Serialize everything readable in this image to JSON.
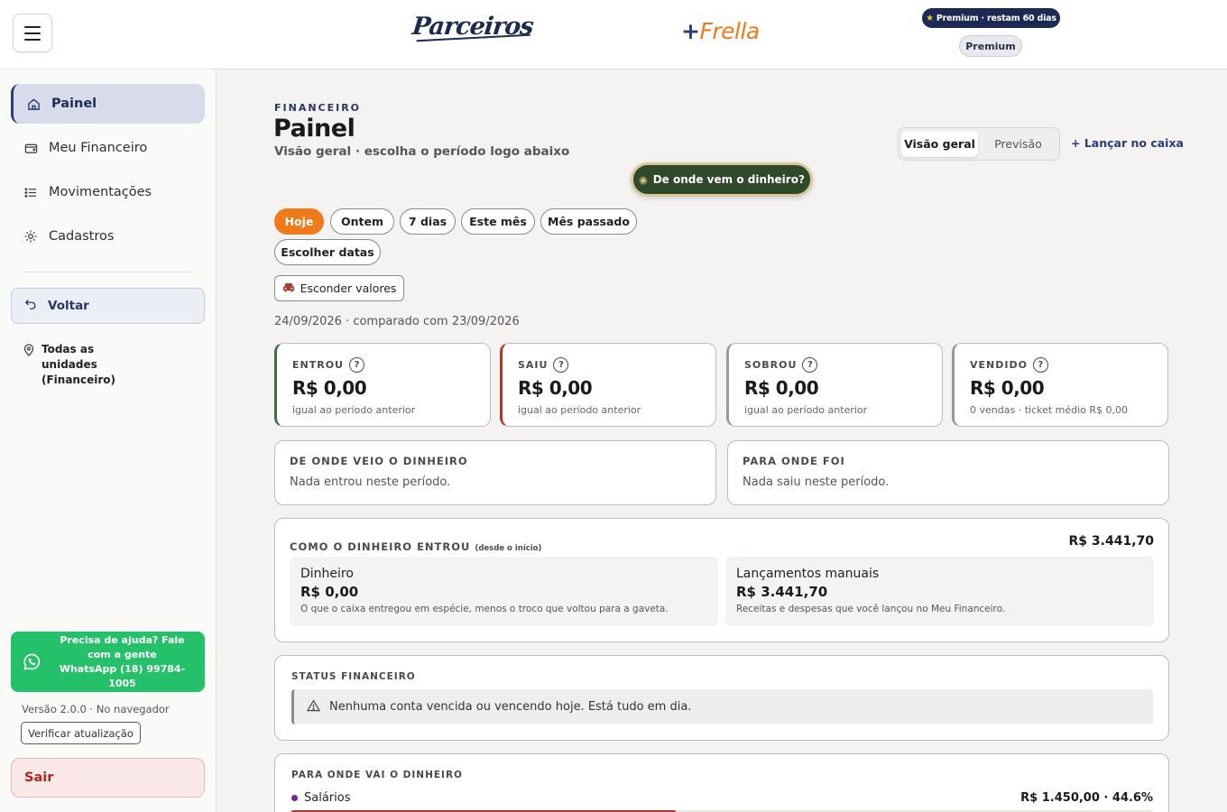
{
  "header": {
    "menu_label": "Menu",
    "logo_parceiros": "Parceiros",
    "logo_frella_plus": "+",
    "logo_frella_name": "Frella",
    "premium_badge": "Premium · restam 60 dias",
    "premium_pill": "Premium"
  },
  "sidebar": {
    "items": [
      {
        "label": "Painel",
        "icon": "home-icon"
      },
      {
        "label": "Meu Financeiro",
        "icon": "wallet-icon"
      },
      {
        "label": "Movimentações",
        "icon": "list-icon"
      },
      {
        "label": "Cadastros",
        "icon": "gear-icon"
      }
    ],
    "back_label": "Voltar",
    "units_label": "Todas as unidades (Financeiro)",
    "help_line1": "Precisa de ajuda? Fale com a gente",
    "help_line2": "WhatsApp (18) 99784-1005",
    "version": "Versão 2.0.0 · No navegador",
    "update_label": "Verificar atualização",
    "logout_label": "Sair"
  },
  "page": {
    "eyebrow": "FINANCEIRO",
    "title": "Painel",
    "subtitle": "Visão geral · escolha o período logo abaixo",
    "tabs": [
      "Visão geral",
      "Previsão"
    ],
    "active_tab": "Visão geral",
    "launch_link": "+ Lançar no caixa",
    "origin_button": "De onde vem o dinheiro?",
    "periods": [
      "Hoje",
      "Ontem",
      "7 dias",
      "Este mês",
      "Mês passado",
      "Escolher datas"
    ],
    "active_period": "Hoje",
    "hide_values": "Esconder valores",
    "compare_text": "24/09/2026 · comparado com 23/09/2026"
  },
  "kpis": [
    {
      "label": "ENTROU",
      "value": "R$ 0,00",
      "note": "igual ao período anterior",
      "color": "#3e6b45"
    },
    {
      "label": "SAIU",
      "value": "R$ 0,00",
      "note": "igual ao período anterior",
      "color": "#b0392b"
    },
    {
      "label": "SOBROU",
      "value": "R$ 0,00",
      "note": "igual ao período anterior",
      "color": "#9a9a9a"
    },
    {
      "label": "VENDIDO",
      "value": "R$ 0,00",
      "note": "0 vendas · ticket médio R$ 0,00",
      "color": "#9a9a9a"
    }
  ],
  "origin_panel": {
    "title": "DE ONDE VEIO O DINHEIRO",
    "text": "Nada entrou neste período."
  },
  "dest_panel": {
    "title": "PARA ONDE FOI",
    "text": "Nada saiu neste período."
  },
  "entry_panel": {
    "title": "COMO O DINHEIRO ENTROU",
    "title_note": "(desde o início)",
    "total": "R$ 3.441,70",
    "boxes": [
      {
        "title": "Dinheiro",
        "value": "R$ 0,00",
        "desc": "O que o caixa entregou em espécie, menos o troco que voltou para a gaveta."
      },
      {
        "title": "Lançamentos manuais",
        "value": "R$ 3.441,70",
        "desc": "Receitas e despesas que você lançou no Meu Financeiro."
      }
    ]
  },
  "status_panel": {
    "title": "STATUS FINANCEIRO",
    "alert": "Nenhuma conta vencida ou vencendo hoje. Está tudo em dia."
  },
  "spend_panel": {
    "title": "PARA ONDE VAI O DINHEIRO",
    "items": [
      {
        "label": "Salários",
        "amount": "R$ 1.450,00 · 44.6%",
        "share": 0.446,
        "color": "#7a1fa0"
      }
    ]
  }
}
